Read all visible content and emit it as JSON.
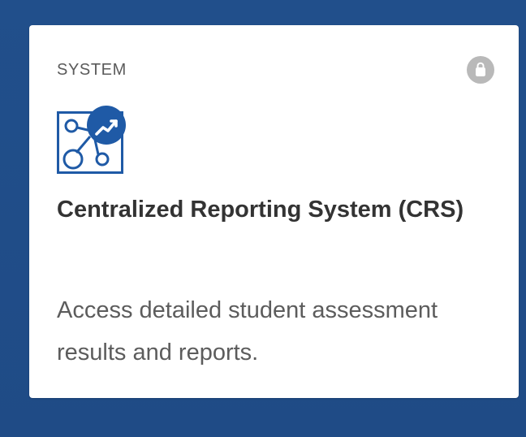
{
  "card": {
    "category": "SYSTEM",
    "title": "Centralized Reporting System (CRS)",
    "description": "Access detailed student assessment results and reports.",
    "icons": {
      "lock": "lock-icon",
      "app": "network-report-icon",
      "badge": "trending-up-icon"
    }
  },
  "colors": {
    "background": "#1f4f8e",
    "card": "#ffffff",
    "accent": "#1f5aa6",
    "lock": "#b9b9b9"
  }
}
